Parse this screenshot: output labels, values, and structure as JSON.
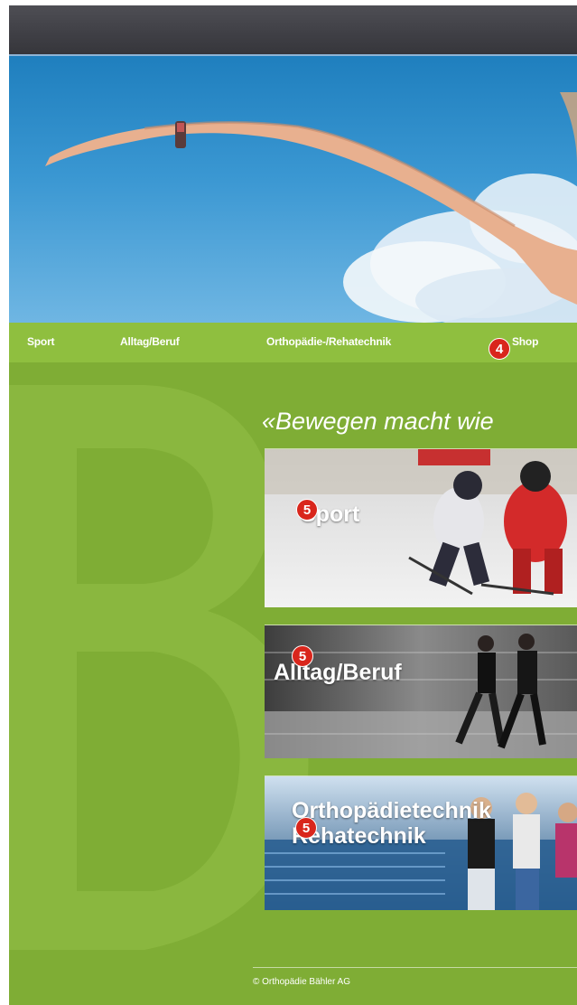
{
  "nav": {
    "items": [
      "Sport",
      "Alltag/Beruf",
      "Orthopädie-/Rehatechnik",
      "Shop"
    ]
  },
  "badges": {
    "shop": "4",
    "tile": "5"
  },
  "tagline": "«Bewegen macht wie",
  "tiles": [
    {
      "label": "Sport"
    },
    {
      "label": "Alltag/Beruf"
    },
    {
      "label_line1": "Orthopädietechnik",
      "label_line2": "Rehatechnik"
    }
  ],
  "footer": {
    "copyright": "© Orthopädie Bähler AG"
  },
  "colors": {
    "brand_green": "#8dbb3f",
    "dark_bar": "#3f3f45",
    "badge_red": "#d9261c"
  },
  "icons": {
    "watermark": "letter-b-watermark"
  }
}
